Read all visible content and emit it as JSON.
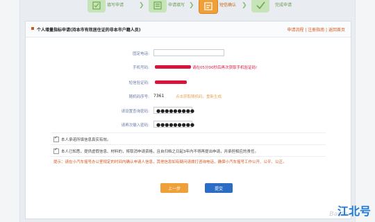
{
  "steps": [
    {
      "label": "填写申请",
      "state": "done"
    },
    {
      "label": "申请填写",
      "state": "done"
    },
    {
      "label": "短信确认",
      "state": "active"
    },
    {
      "label": "完成申请",
      "state": "todo"
    }
  ],
  "header": {
    "title": "个人增量指标申请(持本市有效居住证的非本市户籍人员)",
    "links": "申请流程 | 注册指南 | 返回首页"
  },
  "form": {
    "phone_label": "固定电话:",
    "mobile_label": "手机号码:",
    "mobile_hint": "请在05分00秒后再次获取手机验证码!",
    "sms_label": "短信验证码:",
    "captcha_label": "随机码序号:",
    "captcha_value": "7361",
    "captcha_link": "点击获取随机码，重新生成",
    "password_label": "请设置查询密码:",
    "password_value": "●●●●●●●●●",
    "confirm_label": "请再次输入密码:",
    "confirm_value": "●●●●●●●●●"
  },
  "checks": {
    "c1": "本人承诺所填信息真实有效。",
    "c2": "本人已知悉，提供虚假信息、材料的，将取消申请资格，且自归档之日起3年内不得再提出申请，并承担相应的责任。"
  },
  "notice": "提示：请在小汽车摇号办公室规定的时间内确认申请人信息，其他信息如有疑问请拨打咨询电话，确保小汽车摇号工作公开、公平、公正。",
  "buttons": {
    "prev": "上一步",
    "submit": "提交"
  },
  "watermark": {
    "brand": "江北号",
    "baidu": "Baidu"
  },
  "colors": {
    "accent_orange": "#f0a038",
    "submit_blue": "#2b6cc4",
    "hint_red": "#d9143a"
  }
}
